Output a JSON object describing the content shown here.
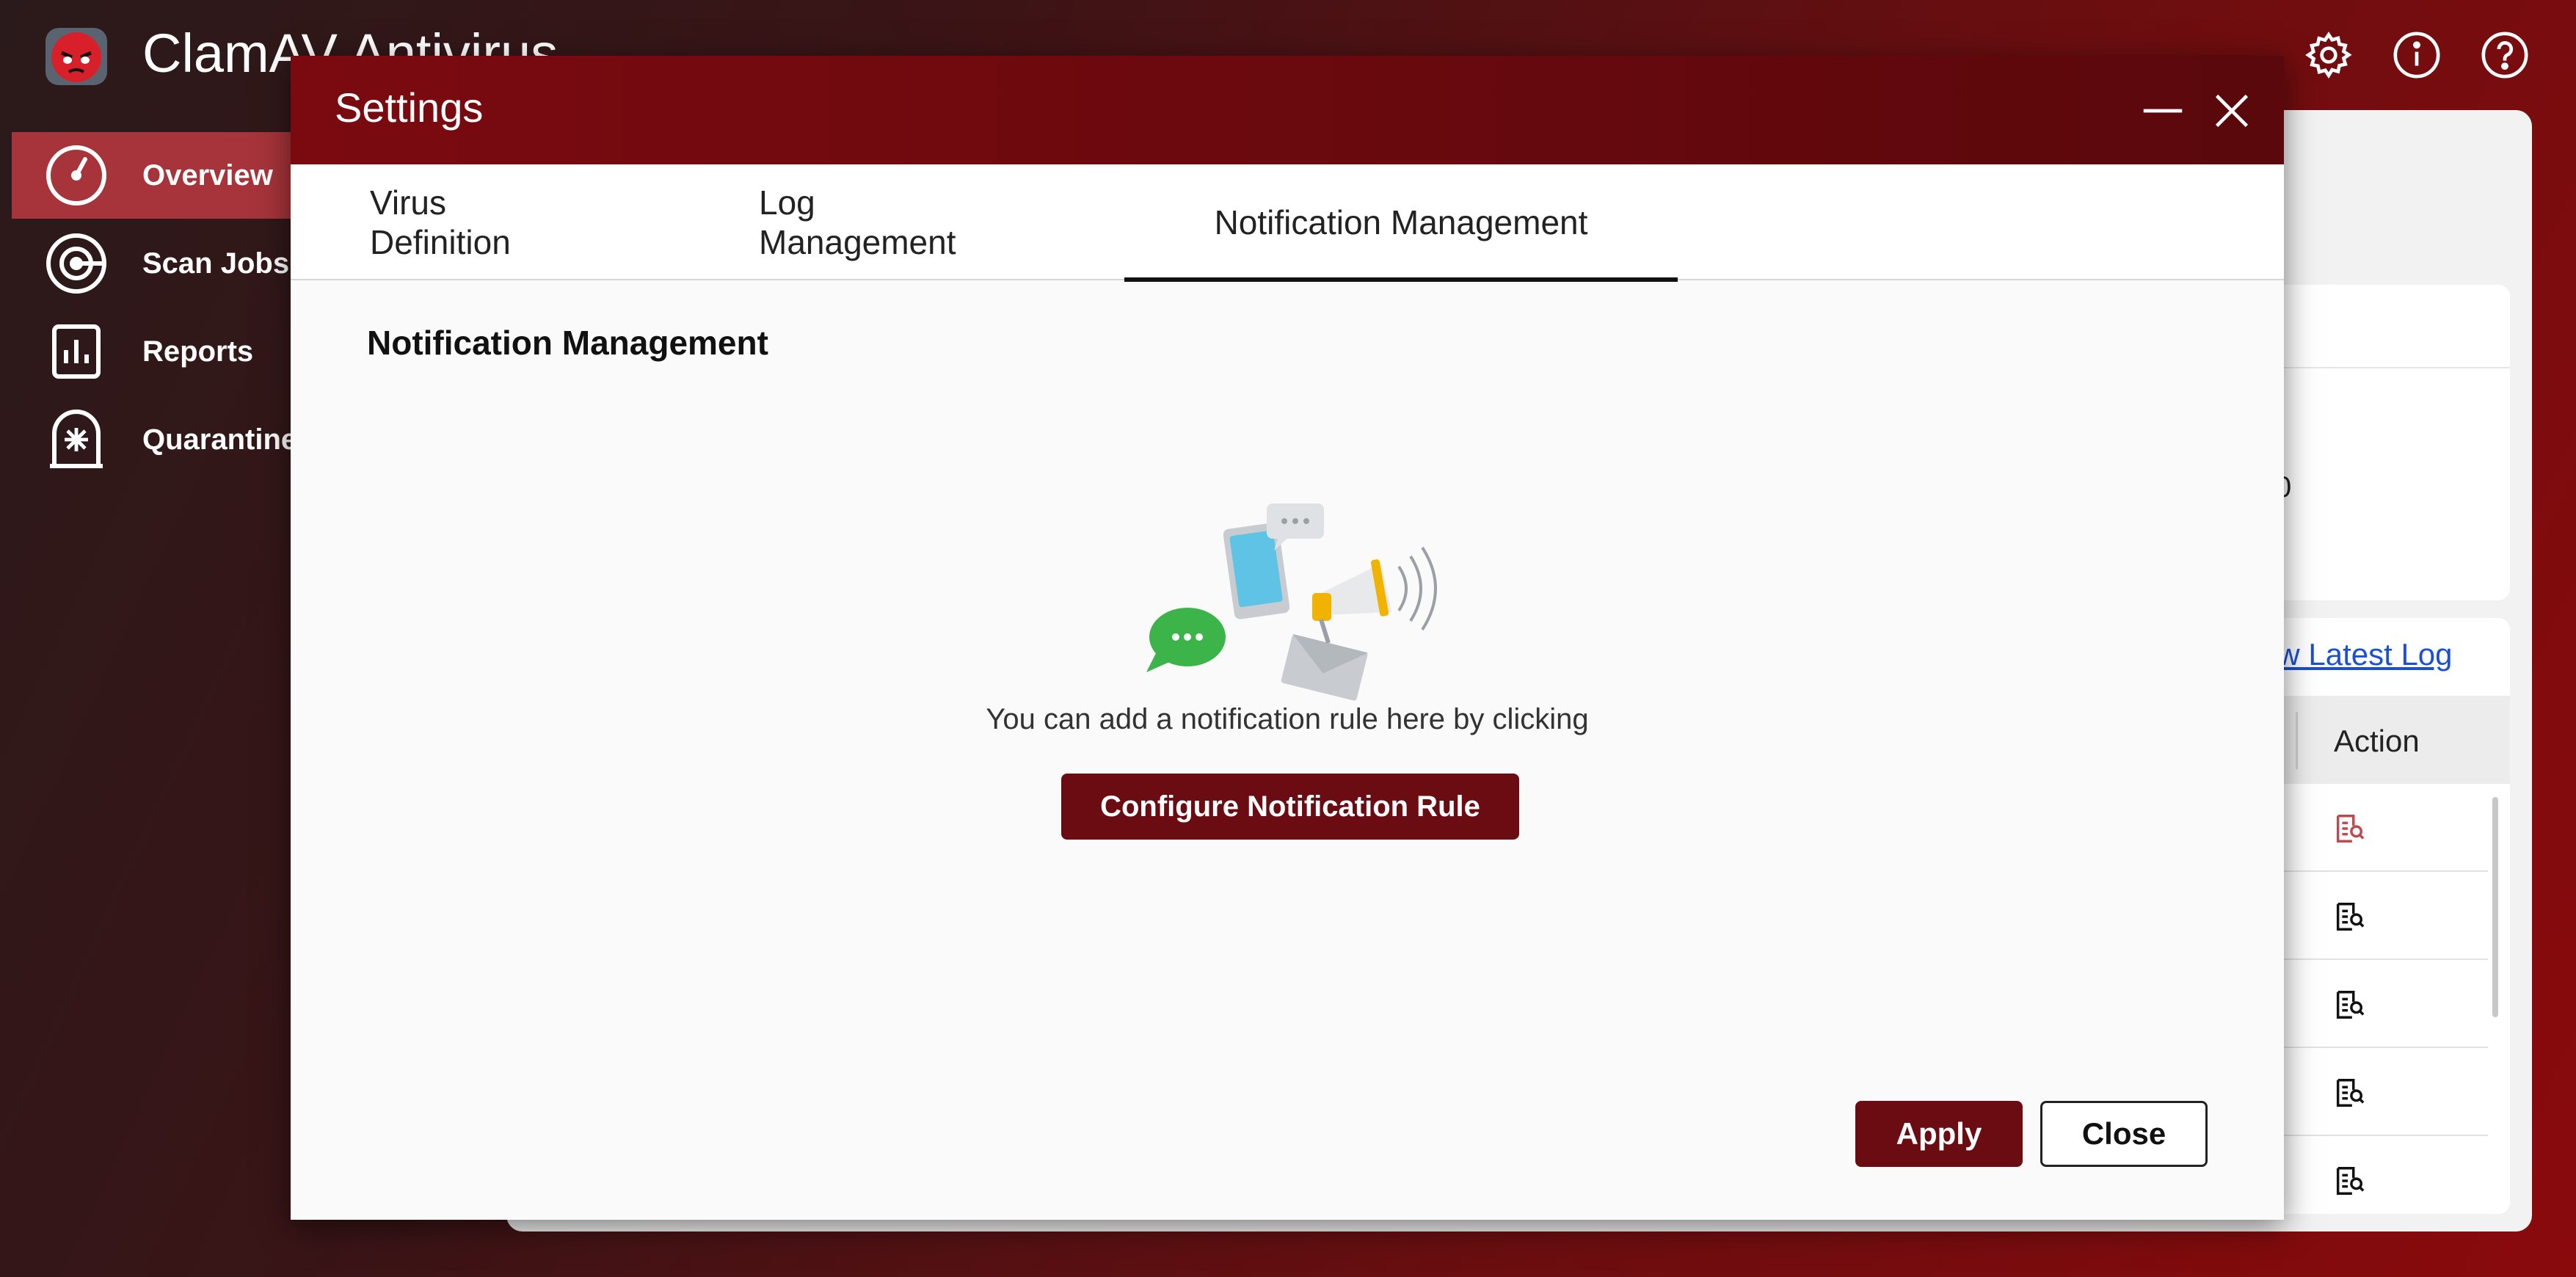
{
  "app": {
    "title": "ClamAV Antivirus"
  },
  "header_icons": [
    "gear-icon",
    "info-icon",
    "help-icon"
  ],
  "sidebar": {
    "items": [
      {
        "label": "Overview",
        "icon": "gauge-icon",
        "active": true
      },
      {
        "label": "Scan Jobs",
        "icon": "target-icon",
        "active": false
      },
      {
        "label": "Reports",
        "icon": "bar-chart-icon",
        "active": false
      },
      {
        "label": "Quarantine",
        "icon": "quarantine-icon",
        "active": false
      }
    ]
  },
  "background": {
    "value_fragment": "0",
    "link": "ew Latest Log",
    "table_header": "Action"
  },
  "modal": {
    "title": "Settings",
    "tabs": [
      {
        "label": "Virus Definition",
        "active": false
      },
      {
        "label": "Log Management",
        "active": false
      },
      {
        "label": "Notification Management",
        "active": true
      }
    ],
    "section_title": "Notification Management",
    "empty_message": "You can add a notification rule here by clicking",
    "configure_button": "Configure Notification Rule",
    "apply_button": "Apply",
    "close_button": "Close"
  },
  "colors": {
    "accent": "#6b0c12",
    "header_red": "#7a0a10",
    "sidebar_active": "#a6343a"
  }
}
